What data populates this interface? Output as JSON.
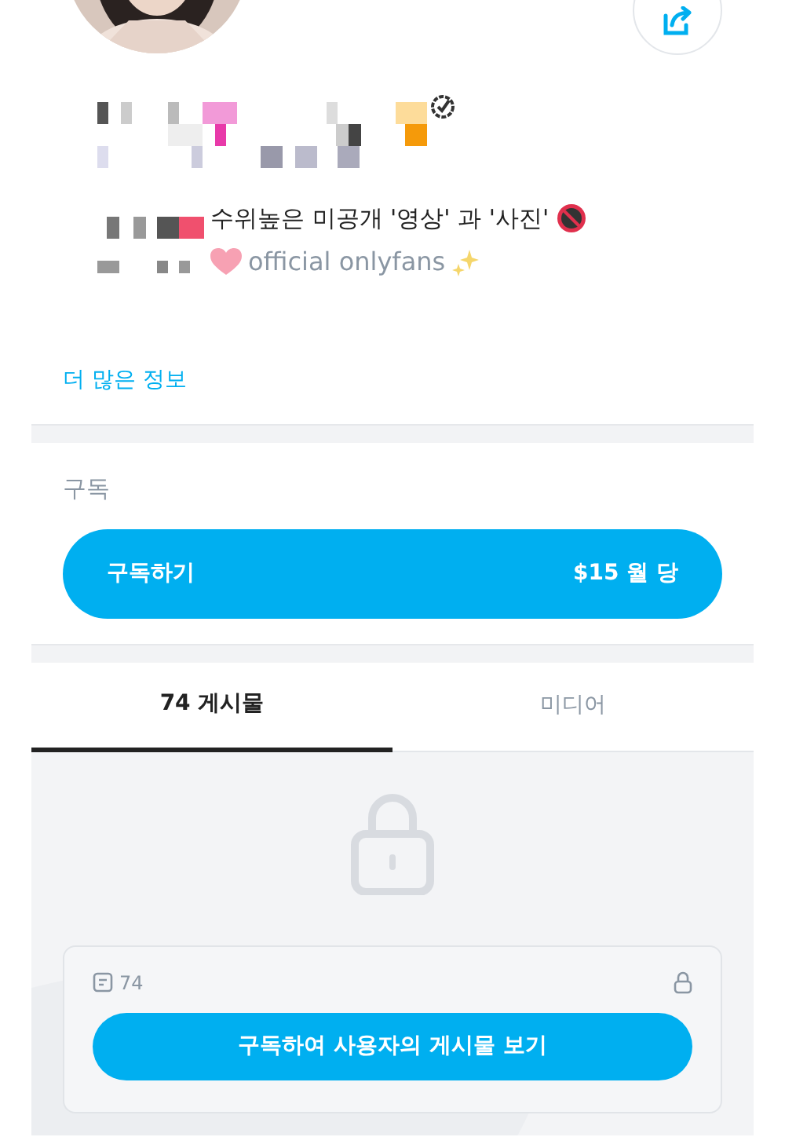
{
  "bio": {
    "line_1": "수위높은 미공개 '영상' 과 '사진'",
    "line_2": "official onlyfans"
  },
  "more_info_link": "더 많은 정보",
  "subscription": {
    "heading": "구독",
    "button_label": "구독하기",
    "price": "$15 월 당"
  },
  "tabs": [
    {
      "label": "74 게시물",
      "selected": true
    },
    {
      "label": "미디어",
      "selected": false
    }
  ],
  "locked": {
    "post_count": "74",
    "button": "구독하여 사용자의 게시물 보기"
  }
}
